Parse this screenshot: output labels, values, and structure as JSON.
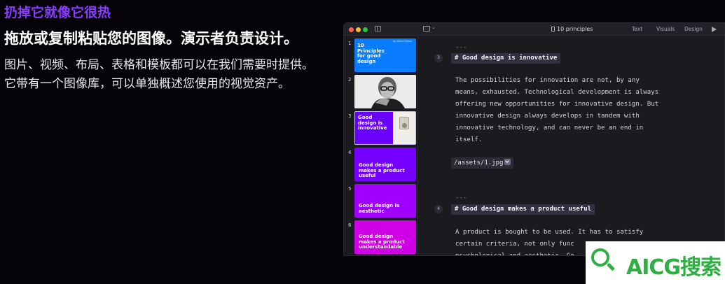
{
  "promo": {
    "eyebrow": "扔掉它就像它很热",
    "headline": "拖放或复制粘贴您的图像。演示者负责设计。",
    "body": "图片、视频、布局、表格和模板都可以在我们需要时提供。它带有一个图像库，可以单独概述您使用的视觉资产。"
  },
  "window": {
    "doc_title": "10 principles",
    "tabs": [
      "Text",
      "Visuals",
      "Design"
    ]
  },
  "slides": [
    {
      "num": "1",
      "text": "10 Principles for good design",
      "byline": "by Dieter Rams"
    },
    {
      "num": "2",
      "text": ""
    },
    {
      "num": "3",
      "text": "Good design is innovative"
    },
    {
      "num": "4",
      "text": "Good design makes a product useful"
    },
    {
      "num": "5",
      "text": "Good design is aesthetic"
    },
    {
      "num": "6",
      "text": "Good design makes a product understandable"
    }
  ],
  "editor": {
    "separator": "---",
    "section3": {
      "num": "3",
      "heading": "# Good design is innovative",
      "paragraph": "The possibilities for innovation are not, by any\nmeans, exhausted. Technological development is always\noffering new opportunities for innovative design. But\ninnovative design always develops in tandem with\ninnovative technology, and can never be an end in\nitself.",
      "asset": "/assets/1.jpg"
    },
    "section4": {
      "num": "4",
      "heading": "# Good design makes a product useful",
      "paragraph": "A product is bought to be used. It has to satisfy\ncertain criteria, not only func\npsychological and aesthetic. Go"
    }
  },
  "watermark": {
    "text": "AICG搜索"
  },
  "colors": {
    "accent": "#8b3dff",
    "watermark": "#2fae43"
  }
}
